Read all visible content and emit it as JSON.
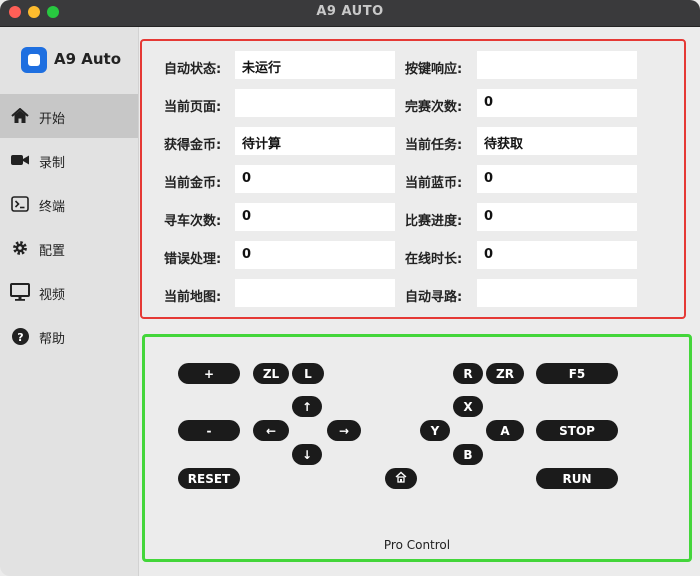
{
  "window": {
    "title": "A9 AUTO"
  },
  "sidebar": {
    "brand": "A9 Auto",
    "items": [
      {
        "label": "开始",
        "icon": "home-icon",
        "active": true
      },
      {
        "label": "录制",
        "icon": "video-camera-icon",
        "active": false
      },
      {
        "label": "终端",
        "icon": "terminal-icon",
        "active": false
      },
      {
        "label": "配置",
        "icon": "gear-icon",
        "active": false
      },
      {
        "label": "视频",
        "icon": "monitor-icon",
        "active": false
      },
      {
        "label": "帮助",
        "icon": "help-icon",
        "active": false
      }
    ]
  },
  "status": {
    "fields": [
      {
        "label": "自动状态:",
        "value": "未运行"
      },
      {
        "label": "按键响应:",
        "value": ""
      },
      {
        "label": "当前页面:",
        "value": ""
      },
      {
        "label": "完赛次数:",
        "value": "0"
      },
      {
        "label": "获得金币:",
        "value": "待计算"
      },
      {
        "label": "当前任务:",
        "value": "待获取"
      },
      {
        "label": "当前金币:",
        "value": "0"
      },
      {
        "label": "当前蓝币:",
        "value": "0"
      },
      {
        "label": "寻车次数:",
        "value": "0"
      },
      {
        "label": "比赛进度:",
        "value": "0"
      },
      {
        "label": "错误处理:",
        "value": "0"
      },
      {
        "label": "在线时长:",
        "value": "0"
      },
      {
        "label": "当前地图:",
        "value": ""
      },
      {
        "label": "自动寻路:",
        "value": ""
      }
    ]
  },
  "controller": {
    "caption": "Pro Control",
    "buttons": {
      "plus": "+",
      "minus": "-",
      "zl": "ZL",
      "l": "L",
      "r": "R",
      "zr": "ZR",
      "f5": "F5",
      "stop": "STOP",
      "run": "RUN",
      "reset": "RESET",
      "up": "↑",
      "down": "↓",
      "left": "←",
      "right": "→",
      "x": "X",
      "y": "Y",
      "a": "A",
      "b": "B"
    }
  },
  "colors": {
    "status_border": "#e53935",
    "controller_border": "#43d63a",
    "brand": "#1e6fe0"
  }
}
